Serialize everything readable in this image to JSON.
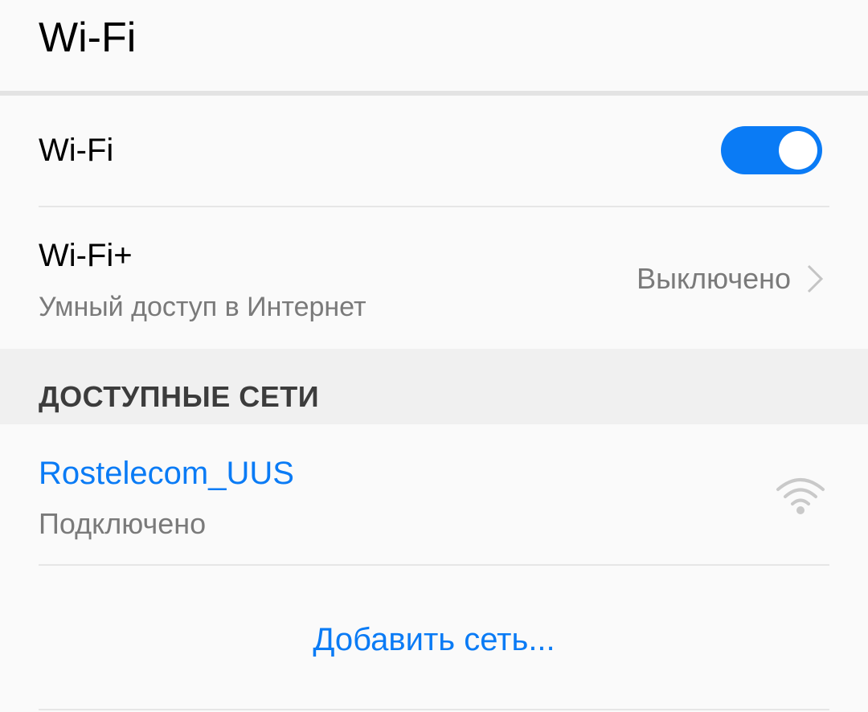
{
  "header": {
    "title": "Wi-Fi"
  },
  "wifi_toggle": {
    "label": "Wi-Fi",
    "state": "on",
    "accent": "#0a7bf5"
  },
  "wifi_plus": {
    "title": "Wi-Fi+",
    "subtitle": "Умный доступ в Интернет",
    "value": "Выключено",
    "chevron_icon": "chevron-right-icon"
  },
  "available_networks": {
    "section_title": "ДОСТУПНЫЕ СЕТИ",
    "networks": [
      {
        "name": "Rostelecom_UUS",
        "status": "Подключено",
        "icon": "wifi-signal-icon"
      }
    ]
  },
  "add_network": {
    "label": "Добавить сеть..."
  }
}
